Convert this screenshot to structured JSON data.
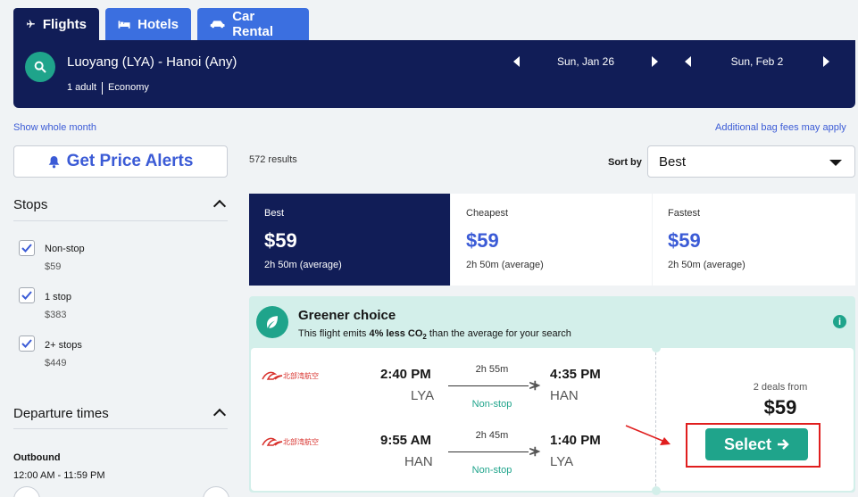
{
  "tabs": [
    {
      "label": "Flights",
      "icon": "plane-icon"
    },
    {
      "label": "Hotels",
      "icon": "bed-icon"
    },
    {
      "label": "Car Rental",
      "icon": "car-icon"
    }
  ],
  "search": {
    "route": "Luoyang (LYA) - Hanoi (Any)",
    "passengers": "1 adult",
    "cabin": "Economy",
    "depart_date": "Sun, Jan 26",
    "return_date": "Sun, Feb 2"
  },
  "links": {
    "show_month": "Show whole month",
    "bag_fees": "Additional bag fees may apply"
  },
  "alerts_button": "Get Price Alerts",
  "filters": {
    "stops_title": "Stops",
    "stops": [
      {
        "label": "Non-stop",
        "price": "$59",
        "checked": true
      },
      {
        "label": "1 stop",
        "price": "$383",
        "checked": true
      },
      {
        "label": "2+ stops",
        "price": "$449",
        "checked": true
      }
    ],
    "departure_title": "Departure times",
    "outbound_label": "Outbound",
    "outbound_range": "12:00 AM - 11:59 PM"
  },
  "results": {
    "count": "572 results",
    "sort_label": "Sort by",
    "sort_value": "Best"
  },
  "sort_tabs": [
    {
      "label": "Best",
      "price": "$59",
      "duration": "2h 50m (average)",
      "active": true
    },
    {
      "label": "Cheapest",
      "price": "$59",
      "duration": "2h 50m (average)",
      "active": false
    },
    {
      "label": "Fastest",
      "price": "$59",
      "duration": "2h 50m (average)",
      "active": false
    }
  ],
  "card": {
    "green_title": "Greener choice",
    "green_sub_pre": "This flight emits ",
    "green_sub_bold": "4% less CO",
    "green_sub_sub": "2",
    "green_sub_post": " than the average for your search",
    "airline_name": "北部湾航空",
    "legs": [
      {
        "depart": "2:40 PM",
        "from": "LYA",
        "duration": "2h 55m",
        "stops": "Non-stop",
        "arrive": "4:35 PM",
        "to": "HAN"
      },
      {
        "depart": "9:55 AM",
        "from": "HAN",
        "duration": "2h 45m",
        "stops": "Non-stop",
        "arrive": "1:40 PM",
        "to": "LYA"
      }
    ],
    "deals": "2 deals from",
    "price": "$59",
    "select": "Select"
  },
  "colors": {
    "navy": "#111d57",
    "blue": "#3b6fe0",
    "teal": "#1fa48b",
    "link": "#3b5bd6",
    "red_highlight": "#e01e1e"
  }
}
